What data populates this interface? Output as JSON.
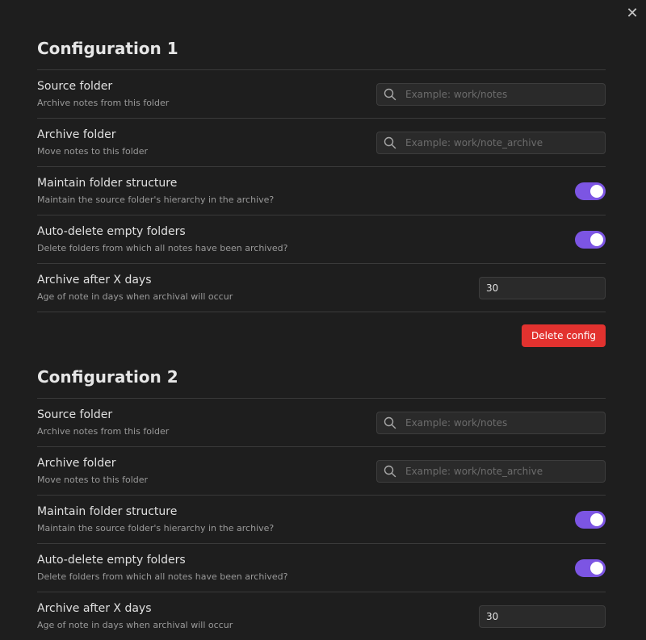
{
  "modal": {
    "close_label": "✕"
  },
  "configs": [
    {
      "heading": "Configuration 1",
      "source_folder": {
        "name": "Source folder",
        "desc": "Archive notes from this folder",
        "placeholder": "Example: work/notes",
        "value": ""
      },
      "archive_folder": {
        "name": "Archive folder",
        "desc": "Move notes to this folder",
        "placeholder": "Example: work/note_archive",
        "value": ""
      },
      "maintain_structure": {
        "name": "Maintain folder structure",
        "desc": "Maintain the source folder's hierarchy in the archive?",
        "enabled": true
      },
      "auto_delete": {
        "name": "Auto-delete empty folders",
        "desc": "Delete folders from which all notes have been archived?",
        "enabled": true
      },
      "archive_after": {
        "name": "Archive after X days",
        "desc": "Age of note in days when archival will occur",
        "value": "30"
      },
      "delete_label": "Delete config"
    },
    {
      "heading": "Configuration 2",
      "source_folder": {
        "name": "Source folder",
        "desc": "Archive notes from this folder",
        "placeholder": "Example: work/notes",
        "value": ""
      },
      "archive_folder": {
        "name": "Archive folder",
        "desc": "Move notes to this folder",
        "placeholder": "Example: work/note_archive",
        "value": ""
      },
      "maintain_structure": {
        "name": "Maintain folder structure",
        "desc": "Maintain the source folder's hierarchy in the archive?",
        "enabled": true
      },
      "auto_delete": {
        "name": "Auto-delete empty folders",
        "desc": "Delete folders from which all notes have been archived?",
        "enabled": true
      },
      "archive_after": {
        "name": "Archive after X days",
        "desc": "Age of note in days when archival will occur",
        "value": "30"
      }
    }
  ],
  "colors": {
    "background": "#1e1e1e",
    "accent": "#7c55e3",
    "danger": "#e2322f"
  },
  "icons": {
    "search": "search-icon",
    "close": "close-icon"
  }
}
